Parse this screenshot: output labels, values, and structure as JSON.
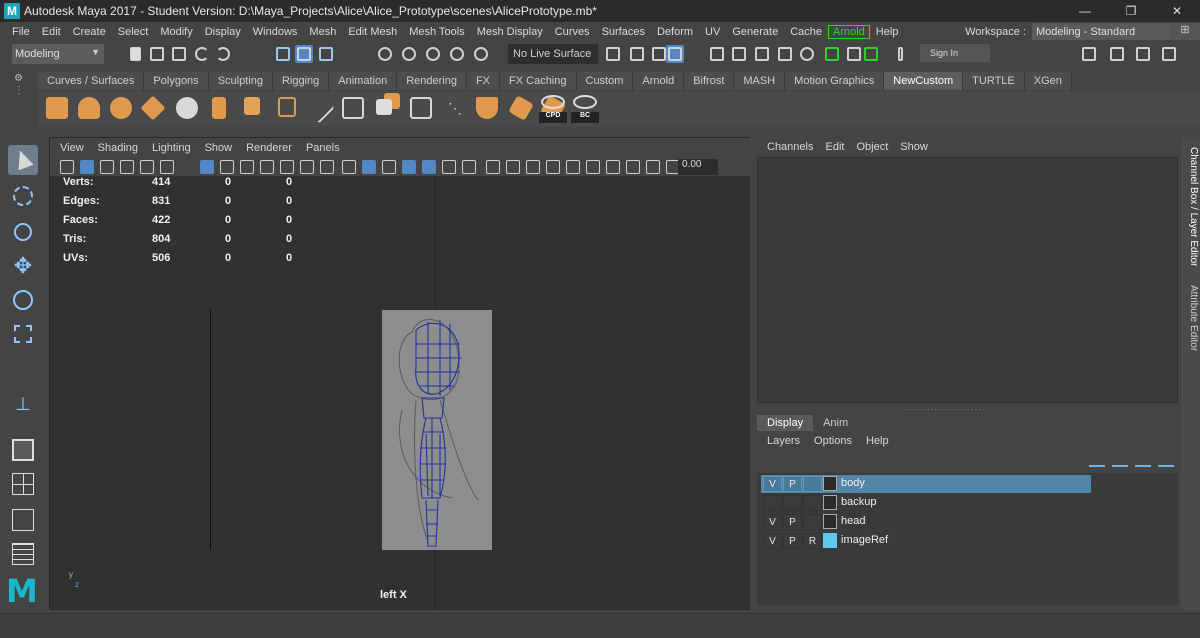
{
  "window": {
    "title": "Autodesk Maya 2017 - Student Version: D:\\Maya_Projects\\Alice\\Alice_Prototype\\scenes\\AlicePrototype.mb*",
    "logo_letter": "M",
    "btn_minimize": "—",
    "btn_restore": "❐",
    "btn_close": "✕"
  },
  "menubar": {
    "items": [
      "File",
      "Edit",
      "Create",
      "Select",
      "Modify",
      "Display",
      "Windows",
      "Mesh",
      "Edit Mesh",
      "Mesh Tools",
      "Mesh Display",
      "Curves",
      "Surfaces",
      "Deform",
      "UV",
      "Generate",
      "Cache",
      "Arnold",
      "Help"
    ],
    "workspace_label": "Workspace :",
    "workspace_value": "Modeling - Standard"
  },
  "statusline": {
    "mode": "Modeling",
    "live_surface": "No Live Surface",
    "sign_in": "Sign In"
  },
  "shelf": {
    "tabs": [
      "Curves / Surfaces",
      "Polygons",
      "Sculpting",
      "Rigging",
      "Animation",
      "Rendering",
      "FX",
      "FX Caching",
      "Custom",
      "Arnold",
      "Bifrost",
      "MASH",
      "Motion Graphics",
      "NewCustom",
      "TURTLE",
      "XGen"
    ],
    "active_tab": "NewCustom",
    "labels": {
      "cpd": "CPD",
      "bc": "BC"
    }
  },
  "viewport": {
    "menu": [
      "View",
      "Shading",
      "Lighting",
      "Show",
      "Renderer",
      "Panels"
    ],
    "zoom_value": "0.00",
    "stats": [
      {
        "label": "Verts:",
        "v1": "414",
        "v2": "0",
        "v3": "0"
      },
      {
        "label": "Edges:",
        "v1": "831",
        "v2": "0",
        "v3": "0"
      },
      {
        "label": "Faces:",
        "v1": "422",
        "v2": "0",
        "v3": "0"
      },
      {
        "label": "Tris:",
        "v1": "804",
        "v2": "0",
        "v3": "0"
      },
      {
        "label": "UVs:",
        "v1": "506",
        "v2": "0",
        "v3": "0"
      }
    ],
    "view_label": "left X",
    "gizmo_y": "y",
    "gizmo_z": "z"
  },
  "channelbox": {
    "menu": [
      "Channels",
      "Edit",
      "Object",
      "Show"
    ]
  },
  "layers": {
    "tabs": [
      "Display",
      "Anim"
    ],
    "menu": [
      "Layers",
      "Options",
      "Help"
    ],
    "rows": [
      {
        "v": "V",
        "p": "P",
        "r": "",
        "name": "body",
        "color": "",
        "selected": true
      },
      {
        "v": "",
        "p": "",
        "r": "",
        "name": "backup",
        "color": "",
        "selected": false
      },
      {
        "v": "V",
        "p": "P",
        "r": "",
        "name": "head",
        "color": "",
        "selected": false
      },
      {
        "v": "V",
        "p": "P",
        "r": "R",
        "name": "imageRef",
        "color": "#5fc8f0",
        "selected": false
      }
    ]
  },
  "side_tabs": [
    "Channel Box / Layer Editor",
    "Attribute Editor"
  ]
}
